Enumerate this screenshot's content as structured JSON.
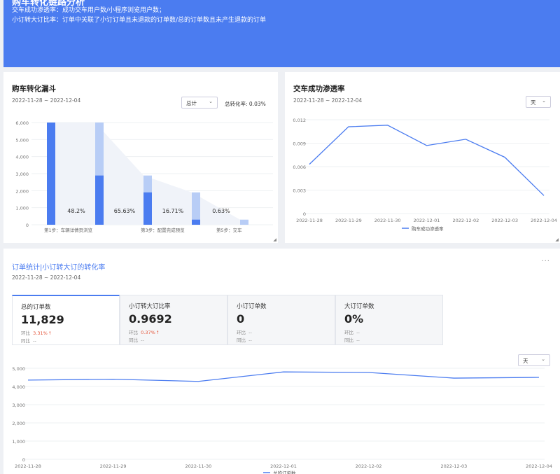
{
  "banner": {
    "title": "购车转化链路分析",
    "line1": "交车成功渗透率：成功交车用户数/小程序浏览用户数；",
    "line2": "小订转大订比率：订单中关联了小订订单且未退款的订单数/总的订单数且未产生退款的订单"
  },
  "funnel_card": {
    "title": "购车转化漏斗",
    "date": "2022-11-28 ~ 2022-12-04",
    "select": "总计",
    "total_rate": "总转化率: 0.03%"
  },
  "penetration_card": {
    "title": "交车成功渗透率",
    "date": "2022-11-28 ~ 2022-12-04",
    "select": "天"
  },
  "orders_card": {
    "title": "订单统计|小订转大订的转化率",
    "date": "2022-11-28 ~ 2022-12-04",
    "more": "···",
    "select": "天",
    "kpis": [
      {
        "label": "总的订单数",
        "value": "11,829",
        "ring_label": "环比",
        "ring_value": "3.31%",
        "ring_arrow": "🠕",
        "yoy_label": "同比",
        "yoy_value": "--"
      },
      {
        "label": "小订转大订比率",
        "value": "0.9692",
        "ring_label": "环比",
        "ring_value": "0.37%",
        "ring_arrow": "🠕",
        "yoy_label": "同比",
        "yoy_value": "--"
      },
      {
        "label": "小订订单数",
        "value": "0",
        "ring_label": "环比",
        "ring_value": "--",
        "ring_arrow": "",
        "yoy_label": "同比",
        "yoy_value": "--"
      },
      {
        "label": "大订订单数",
        "value": "0%",
        "ring_label": "环比",
        "ring_value": "--",
        "ring_arrow": "",
        "yoy_label": "同比",
        "yoy_value": "--"
      }
    ]
  },
  "colors": {
    "accent": "#4b7cf0",
    "bar_dark": "#4b7cf0",
    "bar_light": "#b8cdf6",
    "up": "#e4553a"
  },
  "chart_data": [
    {
      "type": "bar",
      "categories": [
        "第1步：车辆详情页浏览",
        "第2步",
        "第3步：配置完成预览",
        "第4步",
        "第5步：交车"
      ],
      "step_labels": [
        "第1步：车辆详情页浏览",
        "",
        "第3步：配置完成预览",
        "",
        "第5步：交车"
      ],
      "series": [
        {
          "values": [
            6000,
            2890,
            1900,
            300,
            0
          ]
        },
        {
          "values": [
            6000,
            6000,
            2890,
            1900,
            300
          ]
        }
      ],
      "conversion_labels": [
        "48.2%",
        "65.63%",
        "16.71%",
        "0.63%"
      ],
      "yticks": [
        "0",
        "1,000",
        "2,000",
        "3,000",
        "4,000",
        "5,000",
        "6,000"
      ],
      "ylim": [
        0,
        6000
      ]
    },
    {
      "type": "line",
      "x": [
        "2022-11-28",
        "2022-11-29",
        "2022-11-30",
        "2022-12-01",
        "2022-12-02",
        "2022-12-03",
        "2022-12-04"
      ],
      "series": [
        {
          "name": "购车成功渗透率",
          "values": [
            0.0063,
            0.0111,
            0.0113,
            0.0087,
            0.0095,
            0.0072,
            0.0023
          ]
        }
      ],
      "yticks": [
        "0",
        "0.003",
        "0.006",
        "0.009",
        "0.012"
      ],
      "ylim": [
        0,
        0.012
      ]
    },
    {
      "type": "line",
      "x": [
        "2022-11-28",
        "2022-11-29",
        "2022-11-30",
        "2022-12-01",
        "2022-12-02",
        "2022-12-03",
        "2022-12-04"
      ],
      "series": [
        {
          "name": "总的订单数",
          "values": [
            4350,
            4400,
            4280,
            4800,
            4770,
            4460,
            4500
          ]
        }
      ],
      "yticks": [
        "0",
        "1,000",
        "2,000",
        "3,000",
        "4,000",
        "5,000"
      ],
      "ylim": [
        0,
        5000
      ]
    }
  ]
}
